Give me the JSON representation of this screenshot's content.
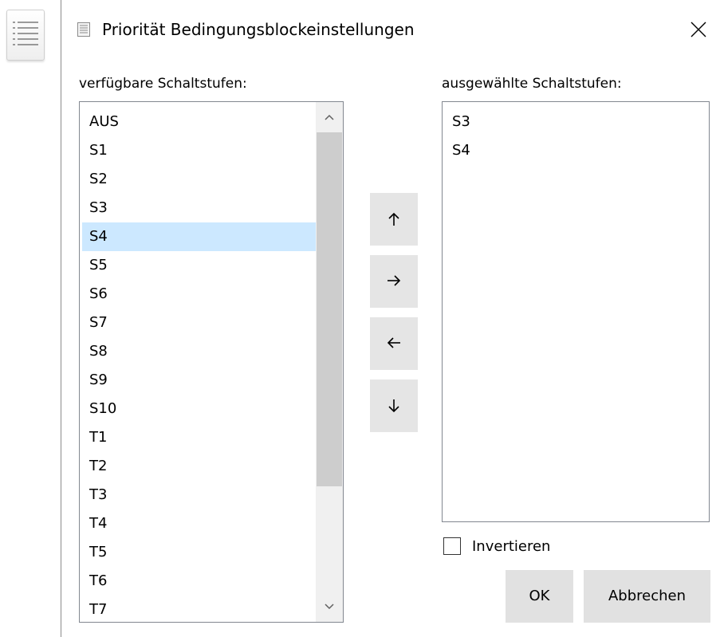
{
  "side_icon": "list-icon",
  "dialog": {
    "title": "Priorität Bedingungsblockeinstellungen",
    "title_icon": "document-list-icon",
    "close_icon": "close-icon"
  },
  "available": {
    "label": "verfügbare Schaltstufen:",
    "items": [
      "AUS",
      "S1",
      "S2",
      "S3",
      "S4",
      "S5",
      "S6",
      "S7",
      "S8",
      "S9",
      "S10",
      "T1",
      "T2",
      "T3",
      "T4",
      "T5",
      "T6",
      "T7"
    ],
    "selected": "S4",
    "scroll_up_icon": "chevron-up-icon",
    "scroll_down_icon": "chevron-down-icon"
  },
  "move_buttons": [
    {
      "icon": "arrow-up-icon",
      "glyph": "↑"
    },
    {
      "icon": "arrow-right-icon",
      "glyph": "→"
    },
    {
      "icon": "arrow-left-icon",
      "glyph": "←"
    },
    {
      "icon": "arrow-down-icon",
      "glyph": "↓"
    }
  ],
  "chosen": {
    "label": "ausgewählte Schaltstufen:",
    "items": [
      "S3",
      "S4"
    ]
  },
  "invert": {
    "label": "Invertieren",
    "checked": false
  },
  "buttons": {
    "ok": "OK",
    "cancel": "Abbrechen"
  },
  "colors": {
    "selection": "#cce8ff",
    "button_bg": "#e1e1e1",
    "scroll_thumb": "#cdcdcd"
  }
}
